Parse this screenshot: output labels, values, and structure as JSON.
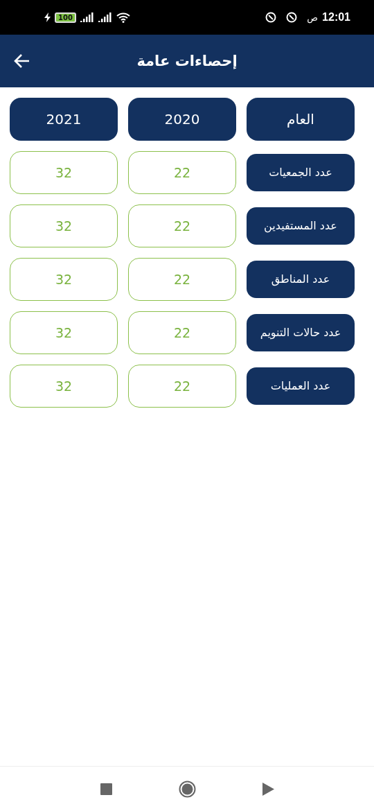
{
  "status_bar": {
    "time": "12:01",
    "period": "ص",
    "battery": "100"
  },
  "app_bar": {
    "title": "إحصاءات عامة"
  },
  "header": [
    "العام",
    "2020",
    "2021"
  ],
  "rows": [
    {
      "label": "عدد الجمعيات",
      "values": [
        "22",
        "32"
      ]
    },
    {
      "label": "عدد المستفيدين",
      "values": [
        "22",
        "32"
      ]
    },
    {
      "label": "عدد المناطق",
      "values": [
        "22",
        "32"
      ]
    },
    {
      "label": "عدد حالات التنويم",
      "values": [
        "22",
        "32"
      ]
    },
    {
      "label": "عدد العمليات",
      "values": [
        "22",
        "32"
      ]
    }
  ]
}
